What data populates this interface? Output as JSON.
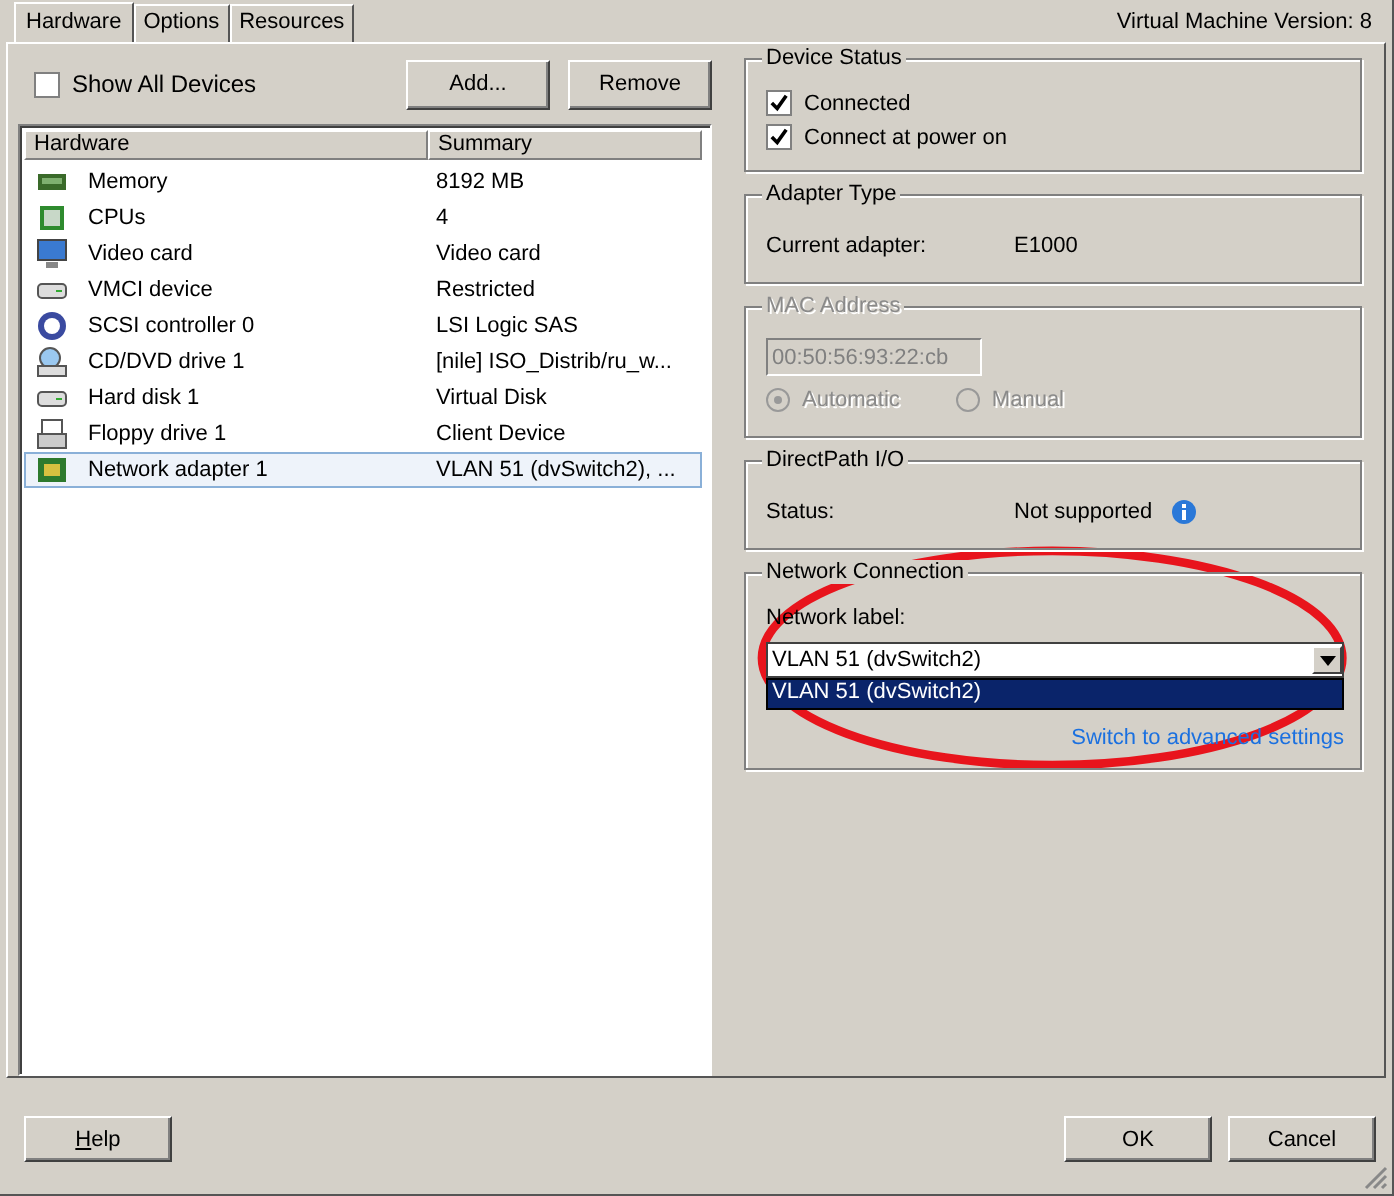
{
  "tabs": [
    {
      "label": "Hardware",
      "selected": true
    },
    {
      "label": "Options",
      "selected": false
    },
    {
      "label": "Resources",
      "selected": false
    }
  ],
  "version": "Virtual Machine Version: 8",
  "show_all_devices": {
    "label": "Show All Devices",
    "checked": false
  },
  "list_buttons": [
    "Add...",
    "Remove"
  ],
  "table": {
    "columns": [
      "Hardware",
      "Summary"
    ],
    "rows": [
      {
        "name": "Memory",
        "summary": "8192 MB",
        "selected": false
      },
      {
        "name": "CPUs",
        "summary": "4",
        "selected": false
      },
      {
        "name": "Video card",
        "summary": "Video card",
        "selected": false
      },
      {
        "name": "VMCI device",
        "summary": "Restricted",
        "selected": false
      },
      {
        "name": "SCSI controller 0",
        "summary": "LSI Logic SAS",
        "selected": false
      },
      {
        "name": "CD/DVD drive 1",
        "summary": "[nile] ISO_Distrib/ru_w...",
        "selected": false
      },
      {
        "name": "Hard disk 1",
        "summary": "Virtual Disk",
        "selected": false
      },
      {
        "name": "Floppy drive 1",
        "summary": "Client Device",
        "selected": false
      },
      {
        "name": "Network adapter 1",
        "summary": "VLAN 51 (dvSwitch2), ...",
        "selected": true
      }
    ]
  },
  "device_status": {
    "title": "Device Status",
    "options": [
      {
        "label": "Connected",
        "checked": true
      },
      {
        "label": "Connect at power on",
        "checked": true
      }
    ]
  },
  "adapter_type": {
    "title": "Adapter Type",
    "label": "Current adapter:",
    "value": "E1000"
  },
  "mac_address": {
    "title": "MAC Address",
    "disabled": true,
    "value": "00:50:56:93:22:cb",
    "radios": [
      {
        "label": "Automatic",
        "selected": true
      },
      {
        "label": "Manual",
        "selected": false
      }
    ]
  },
  "directpath": {
    "title": "DirectPath I/O",
    "label": "Status:",
    "value": "Not supported"
  },
  "network_connection": {
    "title": "Network Connection",
    "label": "Network label:",
    "value": "VLAN 51 (dvSwitch2)",
    "dropdown_items": [
      {
        "label": "VLAN 51 (dvSwitch2)",
        "selected": true
      }
    ],
    "link": "Switch to advanced settings"
  },
  "footer": {
    "help": "Help",
    "buttons": [
      "OK",
      "Cancel"
    ]
  }
}
